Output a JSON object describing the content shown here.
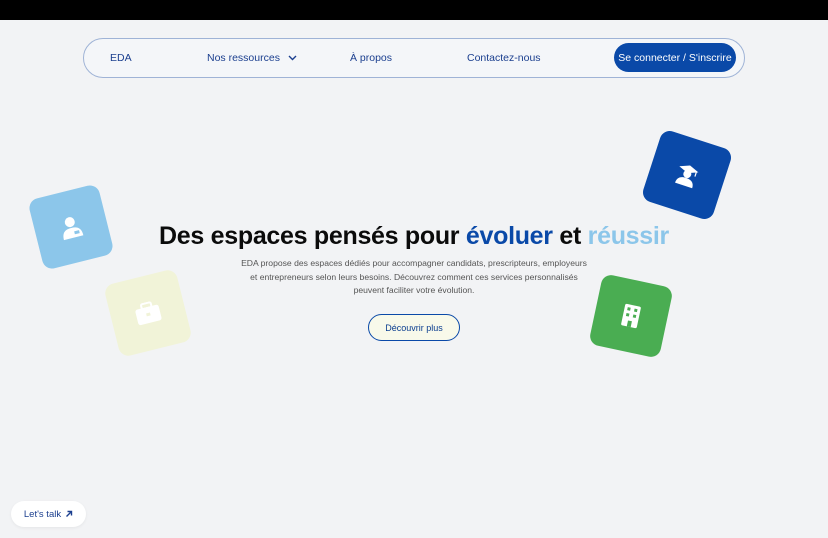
{
  "nav": {
    "brand": "EDA",
    "resources": "Nos ressources",
    "about": "À propos",
    "contact": "Contactez-nous",
    "login": "Se connecter / S'inscrire"
  },
  "hero": {
    "title_part1": "Des espaces pensés pour ",
    "title_accent1": "évoluer",
    "title_part2": " et ",
    "title_accent2": "réussir",
    "desc_line1": "EDA propose des espaces dédiés pour accompagner candidats, prescripteurs, employeurs",
    "desc_line2": "et entrepreneurs selon leurs besoins. Découvrez comment ces services personnalisés",
    "desc_line3": "peuvent faciliter votre évolution.",
    "cta": "Découvrir plus"
  },
  "tiles": [
    {
      "icon": "person-id-icon",
      "color": "#8cc6ea"
    },
    {
      "icon": "briefcase-icon",
      "color": "#f1f3d8"
    },
    {
      "icon": "graduate-icon",
      "color": "#0a49a8"
    },
    {
      "icon": "building-icon",
      "color": "#4aad52"
    }
  ],
  "chat": {
    "label": "Let's talk"
  },
  "colors": {
    "primary": "#0a49a8",
    "accent_light": "#8cc6ea",
    "background": "#f2f3f5"
  }
}
